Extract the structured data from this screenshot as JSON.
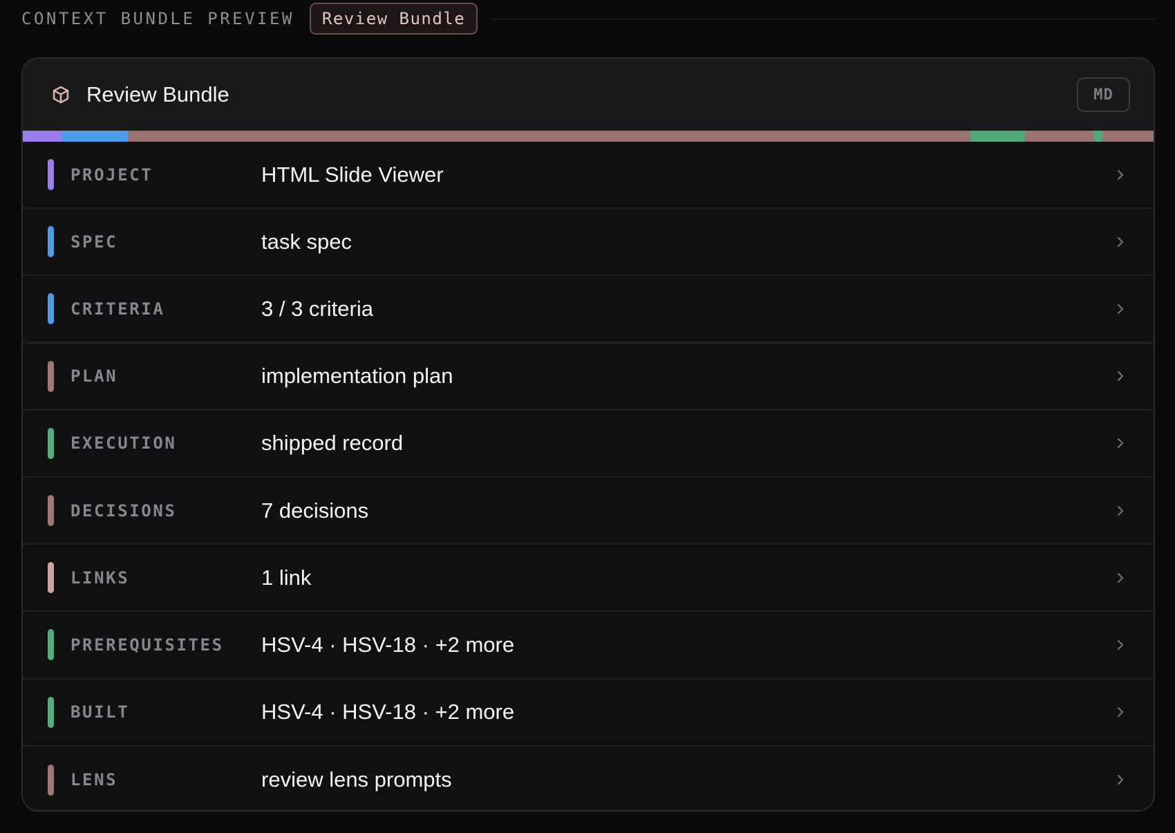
{
  "header": {
    "title": "CONTEXT BUNDLE PREVIEW",
    "active_pill": "Review Bundle"
  },
  "card": {
    "icon": "cube-icon",
    "title": "Review Bundle",
    "format_badge": "MD"
  },
  "colors": {
    "project": "#9b7df0",
    "spec": "#4a9de8",
    "plan": "#a07772",
    "execution": "#4fb07c",
    "links": "#c9a4a0"
  },
  "composition_strip": [
    {
      "section": "project",
      "color": "#9b7df0",
      "fraction": 0.034
    },
    {
      "section": "spec",
      "color": "#4a9de8",
      "fraction": 0.059
    },
    {
      "section": "plan",
      "color": "#9a7470",
      "fraction": 0.745
    },
    {
      "section": "execution",
      "color": "#4fa878",
      "fraction": 0.048
    },
    {
      "section": "decisions",
      "color": "#9a7470",
      "fraction": 0.061
    },
    {
      "section": "links",
      "color": "#4fa878",
      "fraction": 0.008
    },
    {
      "section": "lens",
      "color": "#9a7470",
      "fraction": 0.045
    }
  ],
  "sections": [
    {
      "label": "PROJECT",
      "value": "HTML Slide Viewer",
      "color": "#9b7df0"
    },
    {
      "label": "SPEC",
      "value": "task spec",
      "color": "#4a9de8"
    },
    {
      "label": "CRITERIA",
      "value": "3 / 3 criteria",
      "color": "#4a9de8"
    },
    {
      "label": "PLAN",
      "value": "implementation plan",
      "color": "#a07772"
    },
    {
      "label": "EXECUTION",
      "value": "shipped record",
      "color": "#4fb07c"
    },
    {
      "label": "DECISIONS",
      "value": "7 decisions",
      "color": "#a07772"
    },
    {
      "label": "LINKS",
      "value": "1 link",
      "color": "#c9a4a0"
    },
    {
      "label": "PREREQUISITES",
      "value": "HSV-4 · HSV-18 · +2 more",
      "color": "#4fb07c"
    },
    {
      "label": "BUILT",
      "value": "HSV-4 · HSV-18 · +2 more",
      "color": "#4fb07c"
    },
    {
      "label": "LENS",
      "value": "review lens prompts",
      "color": "#a07772"
    }
  ]
}
